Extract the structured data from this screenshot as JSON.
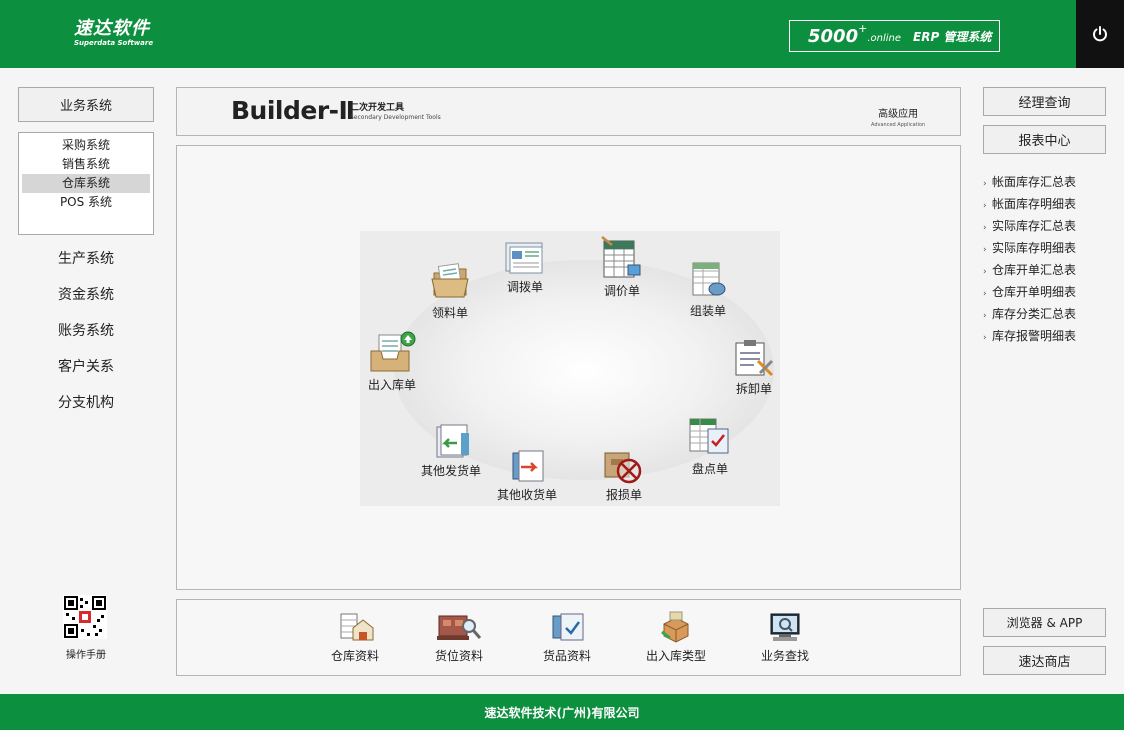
{
  "header": {
    "logo_cn": "速达软件",
    "logo_en": "Superdata Software",
    "brand_num": "5000",
    "brand_plus": "+",
    "brand_online": ".online",
    "brand_erp": "ERP 管理系统",
    "accent": "#0c8f3e"
  },
  "left": {
    "business_btn": "业务系统",
    "sub_items": [
      "采购系统",
      "销售系统",
      "仓库系统",
      "POS 系统"
    ],
    "active_sub": "仓库系统",
    "links": [
      "生产系统",
      "资金系统",
      "账务系统",
      "客户关系",
      "分支机构"
    ],
    "manual": "操作手册"
  },
  "banner": {
    "title": "Builder-Ⅱ",
    "sub_cn": "二次开发工具",
    "sub_en": "Secondary Development Tools",
    "right_cn": "高级应用",
    "right_en": "Advanced Application"
  },
  "flow": {
    "items": [
      "领料单",
      "调拨单",
      "调价单",
      "组装单",
      "出入库单",
      "拆卸单",
      "其他发货单",
      "其他收货单",
      "报损单",
      "盘点单"
    ]
  },
  "tools": [
    "仓库资料",
    "货位资料",
    "货品资料",
    "出入库类型",
    "业务查找"
  ],
  "right": {
    "manager_btn": "经理查询",
    "report_btn": "报表中心",
    "reports": [
      "帐面库存汇总表",
      "帐面库存明细表",
      "实际库存汇总表",
      "实际库存明细表",
      "仓库开单汇总表",
      "仓库开单明细表",
      "库存分类汇总表",
      "库存报警明细表"
    ],
    "browser_btn": "浏览器 & APP",
    "shop_btn": "速达商店"
  },
  "footer": {
    "text": "速达软件技术(广州)有限公司"
  }
}
